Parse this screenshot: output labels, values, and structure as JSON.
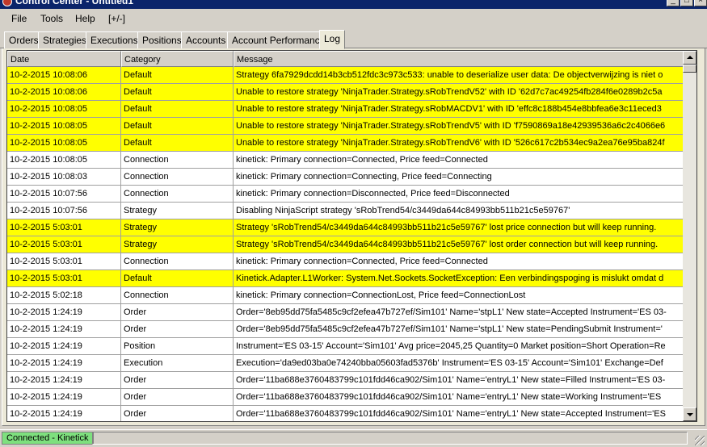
{
  "window": {
    "title": "Control Center - Untitled1",
    "buttons": [
      "_",
      "□",
      "×"
    ]
  },
  "menu": {
    "items": [
      "File",
      "Tools",
      "Help",
      "[+/-]"
    ]
  },
  "tabs": [
    {
      "label": "Orders"
    },
    {
      "label": "Strategies"
    },
    {
      "label": "Executions"
    },
    {
      "label": "Positions"
    },
    {
      "label": "Accounts"
    },
    {
      "label": "Account Performance"
    },
    {
      "label": "Log",
      "active": true
    }
  ],
  "log": {
    "columns": [
      "Date",
      "Category",
      "Message"
    ],
    "highlight_color": "#ffff00",
    "rows": [
      {
        "date": "10-2-2015 10:08:06",
        "category": "Default",
        "message": "Strategy 6fa7929dcdd14b3cb512fdc3c973c533: unable to deserialize user data: De objectverwijzing is niet o",
        "highlight": true
      },
      {
        "date": "10-2-2015 10:08:06",
        "category": "Default",
        "message": "Unable to restore strategy 'NinjaTrader.Strategy.sRobTrendV52' with ID '62d7c7ac49254fb284f6e0289b2c5a",
        "highlight": true
      },
      {
        "date": "10-2-2015 10:08:05",
        "category": "Default",
        "message": "Unable to restore strategy 'NinjaTrader.Strategy.sRobMACDV1' with ID 'effc8c188b454e8bbfea6e3c11eced3",
        "highlight": true
      },
      {
        "date": "10-2-2015 10:08:05",
        "category": "Default",
        "message": "Unable to restore strategy 'NinjaTrader.Strategy.sRobTrendV5' with ID 'f7590869a18e42939536a6c2c4066e6",
        "highlight": true
      },
      {
        "date": "10-2-2015 10:08:05",
        "category": "Default",
        "message": "Unable to restore strategy 'NinjaTrader.Strategy.sRobTrendV6' with ID '526c617c2b534ec9a2ea76e95ba824f",
        "highlight": true
      },
      {
        "date": "10-2-2015 10:08:05",
        "category": "Connection",
        "message": "kinetick: Primary connection=Connected, Price feed=Connected",
        "highlight": false
      },
      {
        "date": "10-2-2015 10:08:03",
        "category": "Connection",
        "message": "kinetick: Primary connection=Connecting, Price feed=Connecting",
        "highlight": false
      },
      {
        "date": "10-2-2015 10:07:56",
        "category": "Connection",
        "message": "kinetick: Primary connection=Disconnected, Price feed=Disconnected",
        "highlight": false
      },
      {
        "date": "10-2-2015 10:07:56",
        "category": "Strategy",
        "message": "Disabling NinjaScript strategy 'sRobTrend54/c3449da644c84993bb511b21c5e59767'",
        "highlight": false
      },
      {
        "date": "10-2-2015 5:03:01",
        "category": "Strategy",
        "message": "Strategy 'sRobTrend54/c3449da644c84993bb511b21c5e59767' lost price connection but will keep running.",
        "highlight": true
      },
      {
        "date": "10-2-2015 5:03:01",
        "category": "Strategy",
        "message": "Strategy 'sRobTrend54/c3449da644c84993bb511b21c5e59767' lost order connection but will keep running.",
        "highlight": true
      },
      {
        "date": "10-2-2015 5:03:01",
        "category": "Connection",
        "message": "kinetick: Primary connection=Connected, Price feed=Connected",
        "highlight": false
      },
      {
        "date": "10-2-2015 5:03:01",
        "category": "Default",
        "message": "Kinetick.Adapter.L1Worker: System.Net.Sockets.SocketException: Een verbindingspoging is mislukt omdat d",
        "highlight": true
      },
      {
        "date": "10-2-2015 5:02:18",
        "category": "Connection",
        "message": "kinetick: Primary connection=ConnectionLost, Price feed=ConnectionLost",
        "highlight": false
      },
      {
        "date": "10-2-2015 1:24:19",
        "category": "Order",
        "message": "Order='8eb95dd75fa5485c9cf2efea47b727ef/Sim101' Name='stpL1' New state=Accepted Instrument='ES 03-",
        "highlight": false
      },
      {
        "date": "10-2-2015 1:24:19",
        "category": "Order",
        "message": "Order='8eb95dd75fa5485c9cf2efea47b727ef/Sim101' Name='stpL1' New state=PendingSubmit Instrument='",
        "highlight": false
      },
      {
        "date": "10-2-2015 1:24:19",
        "category": "Position",
        "message": "Instrument='ES 03-15' Account='Sim101' Avg price=2045,25 Quantity=0 Market position=Short Operation=Re",
        "highlight": false
      },
      {
        "date": "10-2-2015 1:24:19",
        "category": "Execution",
        "message": "Execution='da9ed03ba0e74240bba05603fad5376b' Instrument='ES 03-15' Account='Sim101' Exchange=Def",
        "highlight": false
      },
      {
        "date": "10-2-2015 1:24:19",
        "category": "Order",
        "message": "Order='11ba688e3760483799c101fdd46ca902/Sim101' Name='entryL1' New state=Filled Instrument='ES 03-",
        "highlight": false
      },
      {
        "date": "10-2-2015 1:24:19",
        "category": "Order",
        "message": "Order='11ba688e3760483799c101fdd46ca902/Sim101' Name='entryL1' New state=Working Instrument='ES",
        "highlight": false
      },
      {
        "date": "10-2-2015 1:24:19",
        "category": "Order",
        "message": "Order='11ba688e3760483799c101fdd46ca902/Sim101' Name='entryL1' New state=Accepted Instrument='ES",
        "highlight": false
      }
    ]
  },
  "status": {
    "connection": "Connected - Kinetick",
    "connection_color": "#7ee07e"
  }
}
